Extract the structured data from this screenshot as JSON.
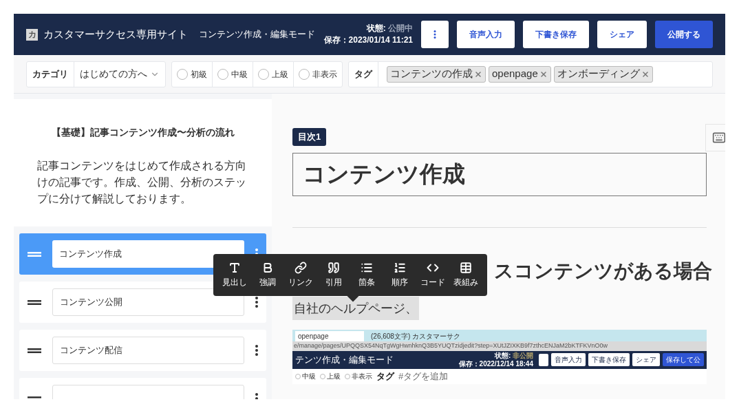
{
  "header": {
    "logo_letter": "カ",
    "site_title": "カスタマーサクセス専用サイト",
    "mode": "コンテンツ作成・編集モード",
    "status_label": "状態:",
    "status_value": "公開中",
    "saved": "保存：2023/01/14 11:21",
    "buttons": [
      {
        "label": "音声入力",
        "kind": "secondary"
      },
      {
        "label": "下書き保存",
        "kind": "secondary"
      },
      {
        "label": "シェア",
        "kind": "secondary"
      },
      {
        "label": "公開する",
        "kind": "primary"
      }
    ]
  },
  "filters": {
    "category_label": "カテゴリ",
    "category_value": "はじめての方へ",
    "levels": [
      {
        "label": "初級",
        "selected": false
      },
      {
        "label": "中級",
        "selected": false
      },
      {
        "label": "上級",
        "selected": false
      },
      {
        "label": "非表示",
        "selected": false
      }
    ],
    "tag_label": "タグ",
    "tags": [
      "コンテンツの作成",
      "openpage",
      "オンボーディング"
    ]
  },
  "sidebar": {
    "title": "【基礎】記事コンテンツ作成〜分析の流れ",
    "description": "記事コンテンツをはじめて作成される方向けの記事です。作成、公開、分析のステップに分けて解説しております。",
    "items": [
      {
        "label": "コンテンツ作成",
        "selected": true
      },
      {
        "label": "コンテンツ公開",
        "selected": false
      },
      {
        "label": "コンテンツ配信",
        "selected": false
      },
      {
        "selected": false
      }
    ]
  },
  "editor": {
    "badge": "目次1",
    "heading": "コンテンツ作成",
    "subheading": "スコンテンツがある場合",
    "paragraph": "自社のヘルプページ、"
  },
  "toolbar": [
    {
      "label": "見出し",
      "kind": "heading"
    },
    {
      "label": "強調",
      "kind": "bold"
    },
    {
      "label": "リンク",
      "kind": "link"
    },
    {
      "label": "引用",
      "kind": "quote"
    },
    {
      "label": "箇条",
      "kind": "list"
    },
    {
      "label": "順序",
      "kind": "ordered"
    },
    {
      "label": "コード",
      "kind": "code"
    },
    {
      "label": "表組み",
      "kind": "table"
    }
  ],
  "embedded_screenshot": {
    "tabs": [
      "openpage",
      "(26,608文字) カスタマーサク"
    ],
    "url": "e/manage/pages/UPQQSX54NqTgWgHwnhknQ3B5YUQTzidjedit?step=XUtJZIXKB9f7zthcENJaM2bKTFKVnO0w",
    "mode": "テンツ作成・編集モード",
    "status_label": "状態:",
    "status_value": "非公開",
    "saved": "保存：2022/12/14 18:44",
    "buttons": [
      {
        "label": "音声入力",
        "kind": "secondary"
      },
      {
        "label": "下書き保存",
        "kind": "secondary"
      },
      {
        "label": "シェア",
        "kind": "secondary"
      },
      {
        "label": "保存して公",
        "kind": "primary"
      }
    ],
    "levels": [
      {
        "label": "中級",
        "selected": false
      },
      {
        "label": "上級",
        "selected": false
      },
      {
        "label": "非表示",
        "selected": false
      }
    ],
    "tag_label": "タグ",
    "tag_placeholder": "#タグを追加"
  }
}
